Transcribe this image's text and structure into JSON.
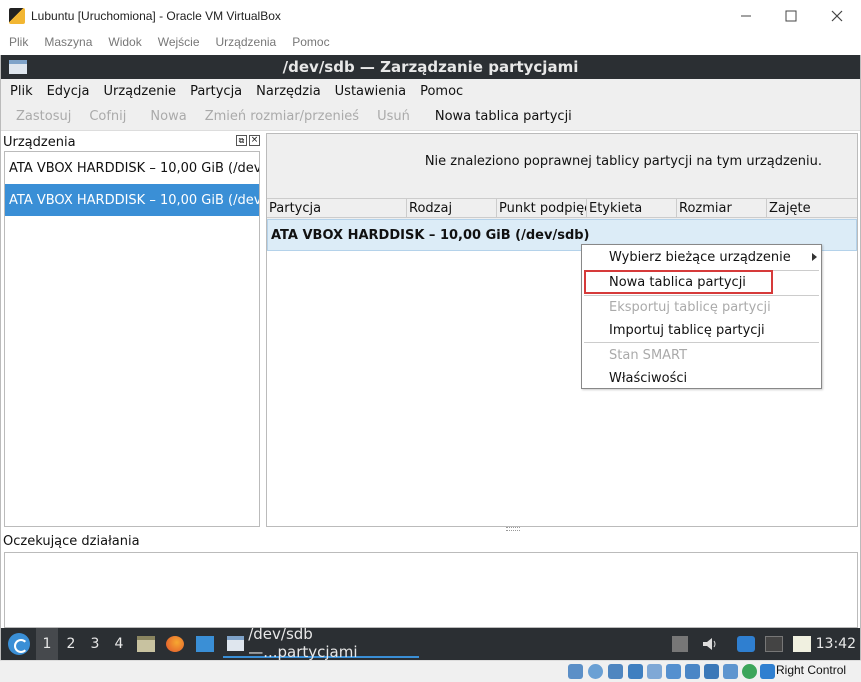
{
  "vbox": {
    "title": "Lubuntu [Uruchomiona] - Oracle VM VirtualBox",
    "menu": [
      "Plik",
      "Maszyna",
      "Widok",
      "Wejście",
      "Urządzenia",
      "Pomoc"
    ],
    "host_key": "Right Control"
  },
  "gparted": {
    "title": "/dev/sdb — Zarządzanie partycjami",
    "menu": [
      "Plik",
      "Edycja",
      "Urządzenie",
      "Partycja",
      "Narzędzia",
      "Ustawienia",
      "Pomoc"
    ],
    "toolbar": {
      "apply": "Zastosuj",
      "undo": "Cofnij",
      "new": "Nowa",
      "resize": "Zmień rozmiar/przenieś",
      "delete": "Usuń",
      "new_table": "Nowa tablica partycji"
    },
    "devices_title": "Urządzenia",
    "devices": [
      "ATA VBOX HARDDISK – 10,00 GiB (/dev...",
      "ATA VBOX HARDDISK – 10,00 GiB (/dev..."
    ],
    "no_table_message": "Nie znaleziono poprawnej tablicy partycji na tym urządzeniu.",
    "columns": [
      "Partycja",
      "Rodzaj",
      "Punkt podpięc",
      "Etykieta",
      "Rozmiar",
      "Zajęte"
    ],
    "disk_row": "ATA VBOX HARDDISK – 10,00 GiB (/dev/sdb)",
    "context_menu": {
      "select_device": "Wybierz bieżące urządzenie",
      "new_table": "Nowa tablica partycji",
      "export_table": "Eksportuj tablicę partycji",
      "import_table": "Importuj tablicę partycji",
      "smart": "Stan SMART",
      "properties": "Właściwości"
    },
    "pending_title": "Oczekujące działania"
  },
  "taskbar": {
    "workspaces": [
      "1",
      "2",
      "3",
      "4"
    ],
    "active_task": "/dev/sdb —...partycjami",
    "clock": "13:42"
  },
  "colors": {
    "panel_dark": "#2b2f33",
    "selection": "#3a8fd6",
    "highlight_border": "#d63a3a"
  }
}
